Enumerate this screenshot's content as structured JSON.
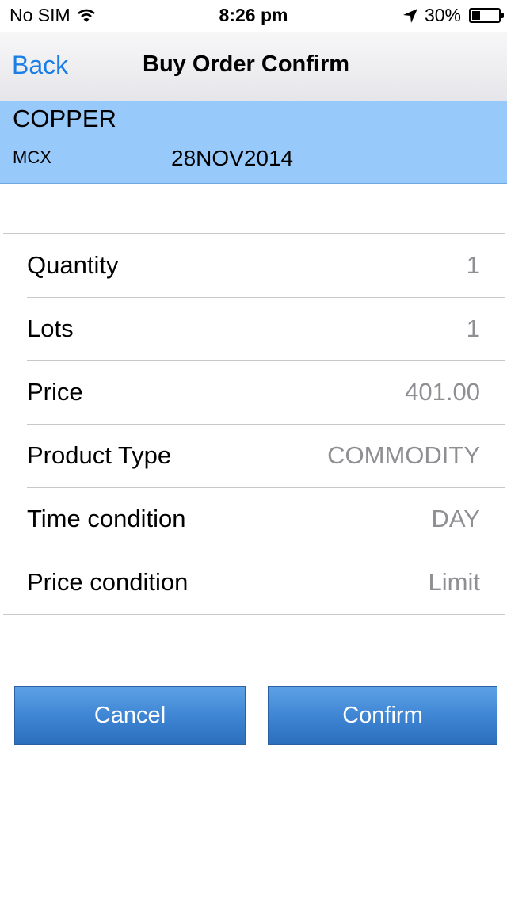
{
  "status_bar": {
    "carrier": "No SIM",
    "time": "8:26 pm",
    "battery": "30%",
    "battery_level": 0.3,
    "icons": [
      "wifi-icon",
      "location-arrow-icon",
      "battery-icon"
    ]
  },
  "nav": {
    "back_label": "Back",
    "title": "Buy Order Confirm"
  },
  "instrument": {
    "name": "COPPER",
    "exchange": "MCX",
    "expiry": "28NOV2014",
    "background": "#98c9fb"
  },
  "details": [
    {
      "label": "Quantity",
      "value": "1"
    },
    {
      "label": "Lots",
      "value": "1"
    },
    {
      "label": "Price",
      "value": "401.00"
    },
    {
      "label": "Product Type",
      "value": "COMMODITY"
    },
    {
      "label": "Time condition",
      "value": "DAY"
    },
    {
      "label": "Price condition",
      "value": "Limit"
    }
  ],
  "buttons": {
    "cancel_label": "Cancel",
    "confirm_label": "Confirm"
  },
  "colors": {
    "accent": "#1a7ee6",
    "button": "#3f86d4",
    "value_text": "#8e8e93"
  }
}
